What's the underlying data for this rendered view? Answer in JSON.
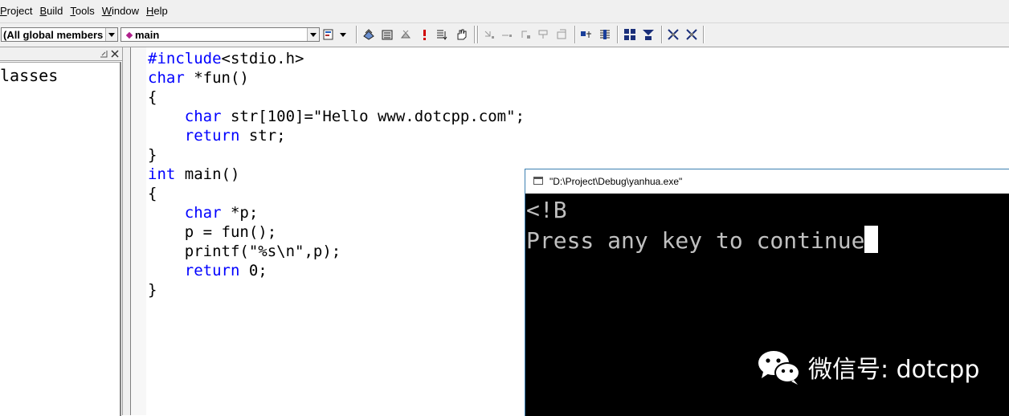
{
  "menubar": {
    "items": [
      {
        "label": "Project",
        "accel": "P",
        "rest": "roject"
      },
      {
        "label": "Build",
        "accel": "B",
        "rest": "uild"
      },
      {
        "label": "Tools",
        "accel": "T",
        "rest": "ools"
      },
      {
        "label": "Window",
        "accel": "W",
        "rest": "indow"
      },
      {
        "label": "Help",
        "accel": "H",
        "rest": "elp"
      }
    ]
  },
  "toolbar": {
    "scope_combo": "(All global members",
    "function_combo": "main"
  },
  "classview": {
    "label": "lasses"
  },
  "editor": {
    "lines": [
      {
        "kw": "#include",
        "rest": "<stdio.h>"
      },
      {
        "kw": "char",
        "rest": " *fun()"
      },
      {
        "kw": "",
        "rest": "{"
      },
      {
        "kw": "    char",
        "rest": " str[100]=\"Hello www.dotcpp.com\";"
      },
      {
        "kw": "    return",
        "rest": " str;"
      },
      {
        "kw": "",
        "rest": "}"
      },
      {
        "kw": "int",
        "rest": " main()"
      },
      {
        "kw": "",
        "rest": "{"
      },
      {
        "kw": "    char",
        "rest": " *p;"
      },
      {
        "kw": "",
        "rest": "    p = fun();"
      },
      {
        "kw": "",
        "rest": "    printf(\"%s\\n\",p);"
      },
      {
        "kw": "    return",
        "rest": " 0;"
      },
      {
        "kw": "",
        "rest": "}"
      }
    ]
  },
  "console": {
    "title": "\"D:\\Project\\Debug\\yanhua.exe\"",
    "line1": "<!B",
    "line2": "Press any key to continue"
  },
  "watermark": {
    "text": "微信号: dotcpp",
    "icon": "wechat-icon"
  },
  "colors": {
    "keyword": "#0000ff",
    "console_bg": "#000000",
    "console_text": "#c0c0c0"
  }
}
